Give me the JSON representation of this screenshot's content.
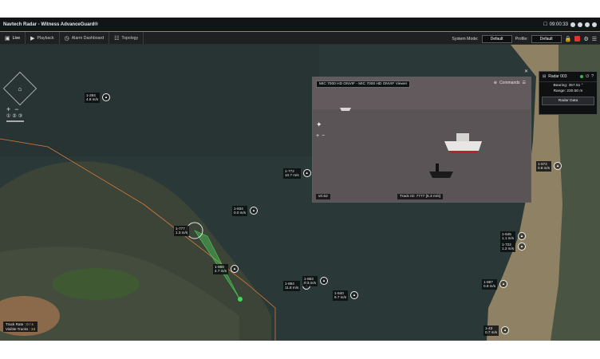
{
  "titlebar": {
    "app_title": "Navtech Radar - Witness AdvanceGuard®",
    "clock": "09:00:33"
  },
  "toolbar": {
    "tabs": [
      {
        "label": "Live"
      },
      {
        "label": "Playback"
      },
      {
        "label": "Alarm Dashboard"
      },
      {
        "label": "Topology"
      }
    ],
    "system_mode_label": "System Mode:",
    "system_mode_value": "Default",
    "profile_label": "Profile:",
    "profile_value": "Default"
  },
  "video": {
    "header": "MIC 7000 HD ONVIF - MIC 7000 HD ONVIF Viewer",
    "commands_label": "Commands",
    "footer_track": "Track ID: 7777 [5.3 m/s]",
    "footer_id": "v0.62"
  },
  "radar_panel": {
    "title": "Radar 003",
    "bearing": "Bearing: 357.51 °",
    "range": "Range: 230.50 m",
    "button": "Radar Data"
  },
  "stats": {
    "track_rate_label": "Track Rate :",
    "track_rate_value": "0 / s",
    "visible_tracks_label": "Visible Tracks :",
    "visible_tracks_value": "24"
  },
  "tracks": [
    {
      "id": "1-284",
      "speed": "4.8 m/s"
    },
    {
      "id": "1-772",
      "speed": "10.7 m/s"
    },
    {
      "id": "1-834",
      "speed": "0.0 m/s"
    },
    {
      "id": "1-777",
      "speed": "1.3 m/s"
    },
    {
      "id": "1-868",
      "speed": "4.7 m/s"
    },
    {
      "id": "1-884",
      "speed": "11.8 m/s"
    },
    {
      "id": "1-853",
      "speed": "0.3 m/s"
    },
    {
      "id": "1-840",
      "speed": "9.7 m/s"
    },
    {
      "id": "1-572",
      "speed": "0.8 m/s"
    },
    {
      "id": "1-645",
      "speed": "1.1 m/s"
    },
    {
      "id": "1-722",
      "speed": "1.2 m/s"
    },
    {
      "id": "1-887",
      "speed": "0.8 m/s"
    },
    {
      "id": "1-43",
      "speed": "0.7 m/s"
    }
  ],
  "colors": {
    "accent_green": "#39b54a",
    "water": "#2c3a3a",
    "land": "#3c4637",
    "sand": "#9a8b6a",
    "boundary_line": "#e07a3a"
  }
}
